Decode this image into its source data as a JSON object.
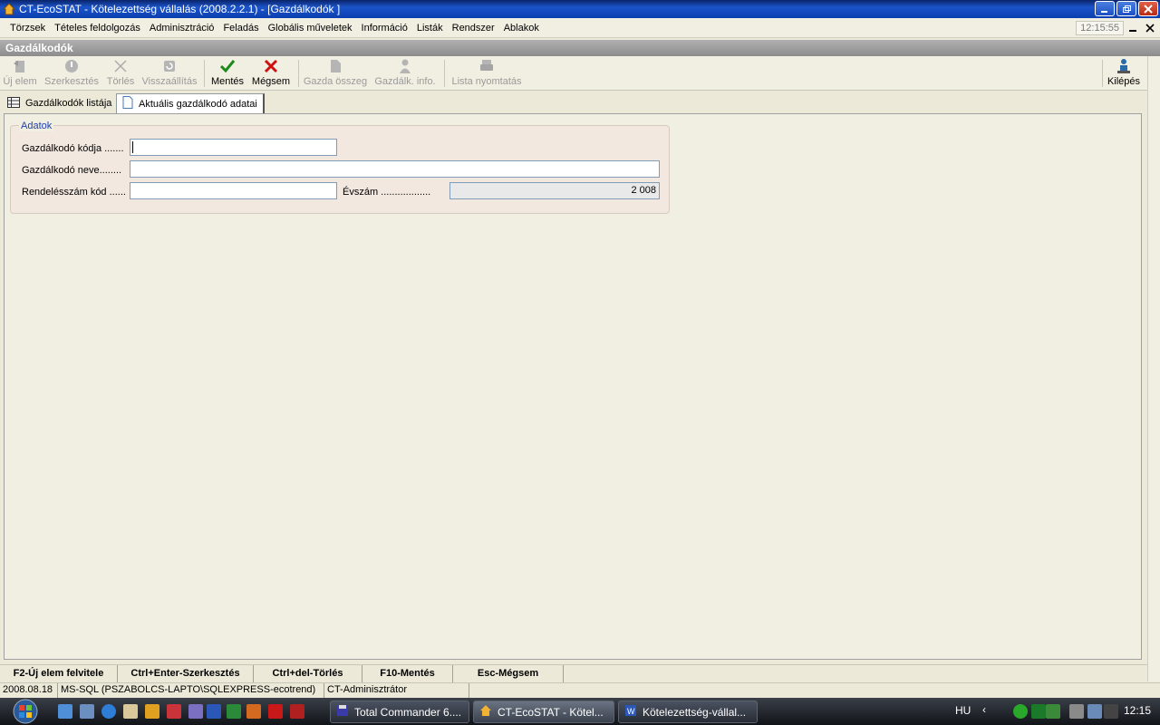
{
  "window": {
    "title": "CT-EcoSTAT - Kötelezettség vállalás (2008.2.2.1) - [Gazdálkodók ]"
  },
  "menu": {
    "items": [
      "Törzsek",
      "Tételes feldolgozás",
      "Adminisztráció",
      "Feladás",
      "Globális műveletek",
      "Információ",
      "Listák",
      "Rendszer",
      "Ablakok"
    ],
    "clock": "12:15:55"
  },
  "form": {
    "caption": "Gazdálkodók"
  },
  "toolbar": {
    "new": "Új elem",
    "edit": "Szerkesztés",
    "delete": "Törlés",
    "restore": "Visszaállítás",
    "save": "Mentés",
    "cancel": "Mégsem",
    "farmer_total": "Gazda összeg",
    "farmer_info": "Gazdálk. info.",
    "print_list": "Lista nyomtatás",
    "exit": "Kilépés"
  },
  "tabs": [
    {
      "label": "Gazdálkodók listája",
      "icon": "grid-icon"
    },
    {
      "label": "Aktuális gazdálkodó adatai",
      "icon": "document-icon"
    }
  ],
  "group": {
    "title": "Adatok",
    "code_label": "Gazdálkodó kódja .......",
    "code_value": "",
    "name_label": "Gazdálkodó neve........",
    "name_value": "",
    "order_label": "Rendelésszám kód ......",
    "order_value": "",
    "year_label": "Évszám ..................",
    "year_value": "2 008"
  },
  "shortcuts": [
    "F2-Új elem felvitele",
    "Ctrl+Enter-Szerkesztés",
    "Ctrl+del-Törlés",
    "F10-Mentés",
    "Esc-Mégsem"
  ],
  "status": {
    "date": "2008.08.18",
    "db": "MS-SQL (PSZABOLCS-LAPTO\\SQLEXPRESS-ecotrend)",
    "user": "CT-Adminisztrátor"
  },
  "taskbar": {
    "tasks": [
      "Total Commander 6....",
      "CT-EcoSTAT - Kötel...",
      "Kötelezettség-vállal..."
    ],
    "lang": "HU",
    "time": "12:15"
  },
  "colors": {
    "titlebar": "#0b3fb0",
    "group_title": "#1c3fb4",
    "save_green": "#1a8a1a",
    "cancel_red": "#cc1111"
  }
}
